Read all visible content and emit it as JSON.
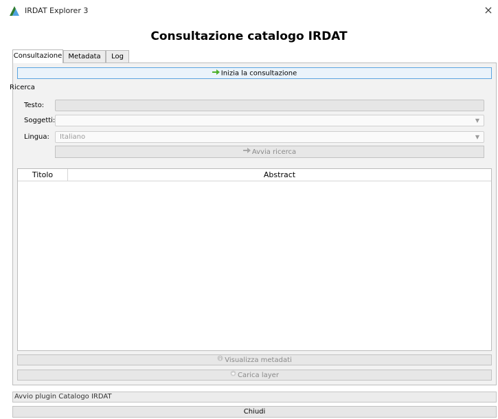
{
  "window": {
    "title": "IRDAT Explorer 3",
    "close_glyph": "×",
    "icon": "irdat-logo-icon"
  },
  "header": {
    "title": "Consultazione catalogo IRDAT"
  },
  "tabs": [
    {
      "label": "Consultazione",
      "active": true
    },
    {
      "label": "Metadata",
      "active": false
    },
    {
      "label": "Log",
      "active": false
    }
  ],
  "start_button": {
    "label": "Inizia la consultazione",
    "icon": "green-arrow-right-icon"
  },
  "search": {
    "section_label": "Ricerca",
    "testo_label": "Testo:",
    "testo_value": "",
    "soggetti_label": "Soggetti:",
    "soggetti_value": "",
    "lingua_label": "Lingua:",
    "lingua_value": "Italiano",
    "search_button": "Avvia ricerca",
    "search_icon": "arrow-right-icon"
  },
  "results_table": {
    "columns": [
      "Titolo",
      "Abstract"
    ],
    "rows": []
  },
  "actions": {
    "view_metadata": "Visualizza metadati",
    "view_metadata_icon": "info-icon",
    "load_layer": "Carica layer",
    "load_layer_icon": "layer-icon"
  },
  "status": {
    "text": "Avvio plugin Catalogo IRDAT"
  },
  "footer": {
    "close_label": "Chiudi"
  },
  "colors": {
    "accent_border": "#5aa4e0",
    "arrow_green": "#4caf2a",
    "panel_bg": "#f2f2f2"
  }
}
